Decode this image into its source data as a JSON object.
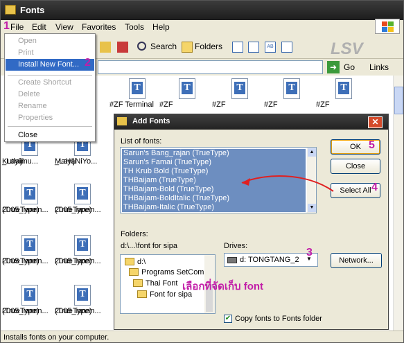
{
  "window": {
    "title": "Fonts"
  },
  "menubar": [
    "File",
    "Edit",
    "View",
    "Favorites",
    "Tools",
    "Help"
  ],
  "toolbar": {
    "search": "Search",
    "folders": "Folders"
  },
  "addressbar": {
    "go": "Go",
    "links": "Links"
  },
  "watermark": "LSV",
  "file_menu": {
    "items": [
      "Open",
      "Print",
      "Install New Font...",
      "Create Shortcut",
      "Delete",
      "Rename",
      "Properties",
      "Close"
    ]
  },
  "files": [
    {
      "line1": "#ZF Terminal",
      "line2": ""
    },
    {
      "line1": "#ZF",
      "line2": ""
    },
    {
      "line1": "#ZF",
      "line2": ""
    },
    {
      "line1": "#ZF",
      "line2": ""
    },
    {
      "line1": "#ZF",
      "line2": ""
    },
    {
      "line1": "_Layiji",
      "line2": "Kutlaimu..."
    },
    {
      "line1": "_Layiji",
      "line2": "MaHaNiYo..."
    },
    {
      "line1": "2005_iannn...",
      "line2": "(TrueType)"
    },
    {
      "line1": "2005_iannn...",
      "line2": "(TrueType)"
    },
    {
      "line1": "2005_iannn...",
      "line2": "(TrueType)"
    },
    {
      "line1": "2005_iannn...",
      "line2": "(TrueType)"
    },
    {
      "line1": "2005_iannn...",
      "line2": "(TrueType)"
    },
    {
      "line1": "2005_iannn...",
      "line2": "(TrueType)"
    }
  ],
  "statusbar": "Installs fonts on your computer.",
  "dialog": {
    "title": "Add Fonts",
    "list_label": "List of fonts:",
    "fonts": [
      "Sarun's Bang_rajan (TrueType)",
      "Sarun's Famai (TrueType)",
      "TH Krub Bold (TrueType)",
      "THBaijam (TrueType)",
      "THBaijam-Bold (TrueType)",
      "THBaijam-BoldItalic (TrueType)",
      "THBaijam-Italic (TrueType)"
    ],
    "ok": "OK",
    "close": "Close",
    "select_all": "Select All",
    "folders_label": "Folders:",
    "folders_path": "d:\\...\\font for sipa",
    "folders": [
      "d:\\",
      "Programs SetCom",
      "Thai Font",
      "Font for sipa"
    ],
    "drives_label": "Drives:",
    "drive": "d: TONGTANG_2",
    "network": "Network...",
    "copy_fonts": "Copy fonts to Fonts folder",
    "copy_checked": true
  },
  "annotations": {
    "n1": "1",
    "n2": "2",
    "n3": "3",
    "n4": "4",
    "n5": "5",
    "thai_note": "เลือกที่จัดเก็บ font"
  },
  "colors": {
    "annotation": "#c21ea8",
    "selection": "#6d8ec0",
    "arrow": "#e02020"
  }
}
